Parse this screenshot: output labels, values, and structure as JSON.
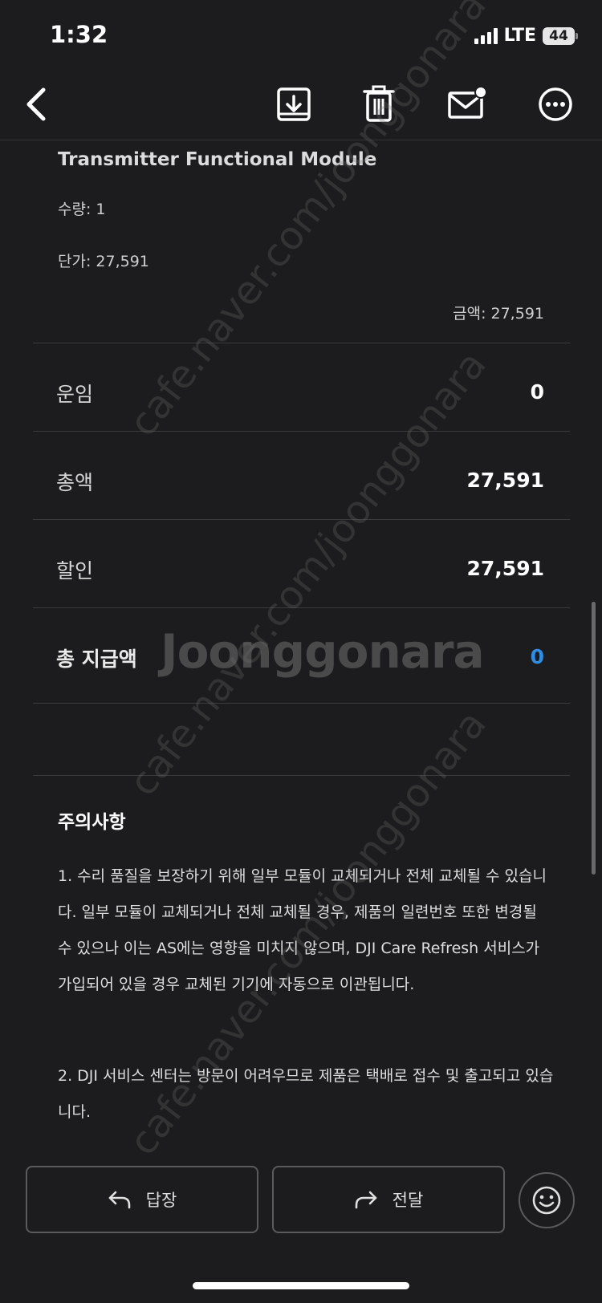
{
  "status_bar": {
    "time": "1:32",
    "network": "LTE",
    "battery": "44"
  },
  "toolbar": {
    "back_icon": "chevron-left-icon",
    "archive_icon": "archive-icon",
    "delete_icon": "trash-icon",
    "unread_icon": "mail-unread-icon",
    "more_icon": "more-icon"
  },
  "item": {
    "name": "Transmitter Functional Module",
    "quantity": "수량: 1",
    "unit_price": "단가: 27,591",
    "amount": "금액: 27,591"
  },
  "summary": [
    {
      "label": "운임",
      "value": "0"
    },
    {
      "label": "총액",
      "value": "27,591"
    },
    {
      "label": "할인",
      "value": "27,591"
    }
  ],
  "total": {
    "label": "총 지급액",
    "value": "0",
    "color": "#2e8de3"
  },
  "notice": {
    "title": "주의사항",
    "paragraphs": [
      "1. 수리 품질을 보장하기 위해 일부 모듈이 교체되거나 전체 교체될 수 있습니다. 일부 모듈이 교체되거나 전체 교체될 경우, 제품의 일련번호 또한 변경될 수 있으나 이는 AS에는 영향을 미치지 않으며, DJI Care Refresh 서비스가 가입되어 있을 경우 교체된 기기에 자동으로 이관됩니다.",
      "2.  DJI 서비스 센터는 방문이 어려우므로 제품은 택배로 접수 및 출고되고 있습니다."
    ]
  },
  "watermark": {
    "brand": "Joonggonara",
    "url": "cafe.naver.com/joonggonara"
  },
  "bottom_bar": {
    "reply_label": "답장",
    "forward_label": "전달",
    "emoji_icon": "smiley-icon"
  }
}
